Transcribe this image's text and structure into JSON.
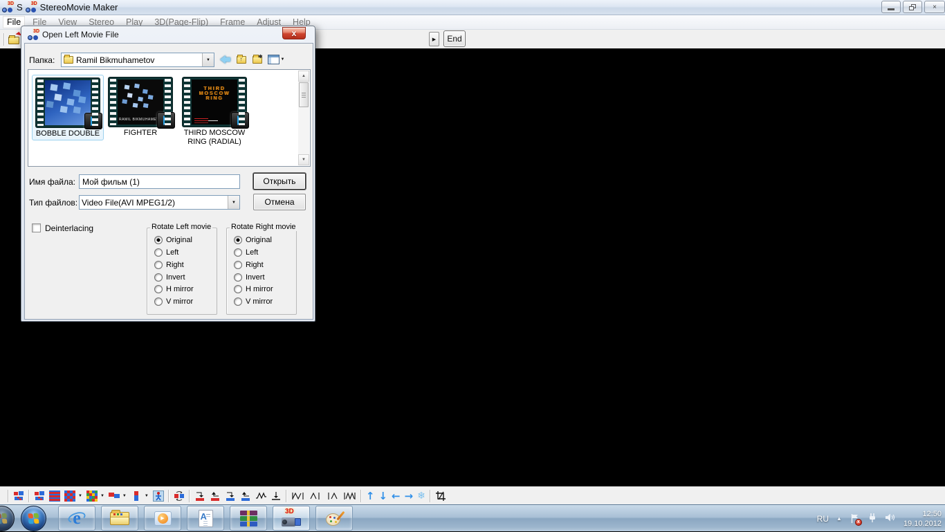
{
  "window": {
    "title_prefix": "S",
    "title": "StereoMovie Maker"
  },
  "menu": {
    "active_item": "File",
    "items": [
      "File",
      "View",
      "Stereo",
      "Play",
      "3D(Page-Flip)",
      "Frame",
      "Adjust",
      "Help"
    ]
  },
  "top_toolbar": {
    "more_glyph": "▶",
    "end_label": "End"
  },
  "dialog": {
    "title": "Open Left Movie File",
    "close_glyph": "x",
    "folder_label": "Папка:",
    "folder_value": "Ramil Bikmuhametov",
    "files": [
      {
        "name": "BOBBLE DOUBLE",
        "selected": true
      },
      {
        "name": "FIGHTER",
        "caption": "RAMIL BIKMUHAMETOV"
      },
      {
        "name": "THIRD MOSCOW RING (RADIAL)",
        "thumb_text": "THIRD\nMOSCOW\nRING"
      }
    ],
    "filename_label": "Имя файла:",
    "filename_value": "Мой фильм (1)",
    "filetype_label": "Тип файлов:",
    "filetype_value": "Video File(AVI MPEG1/2)",
    "open_label": "Открыть",
    "cancel_label": "Отмена",
    "deinterlacing_label": "Deinterlacing",
    "rotate_left_title": "Rotate Left movie",
    "rotate_right_title": "Rotate Right movie",
    "rotate_options": [
      "Original",
      "Left",
      "Right",
      "Invert",
      "H mirror",
      "V mirror"
    ],
    "rotate_left_selected": "Original",
    "rotate_right_selected": "Original"
  },
  "icons": {
    "caret": "▼",
    "scroll_up": "▲",
    "scroll_down": "▼",
    "folder_up_glyph": "↑",
    "new_folder_glyph": "✱",
    "move_up": "↑",
    "move_down": "↓",
    "move_left": "←",
    "move_right": "→",
    "snowflake": "❄",
    "smm_3d": "3D",
    "ie_e": "e",
    "doc_a": "A",
    "play_glyph": "▶"
  },
  "tray": {
    "language": "RU",
    "chevron": "▲",
    "badge_glyph": "x",
    "time": "12:50",
    "date": "19.10.2012"
  },
  "colors": {
    "anaglyph_red": "#d92b2b",
    "anaglyph_blue": "#2b6bd9",
    "dialog_close_red": "#cf4530",
    "selection_border": "#9cd1ee",
    "arrow_blue": "#2f8fe8"
  }
}
